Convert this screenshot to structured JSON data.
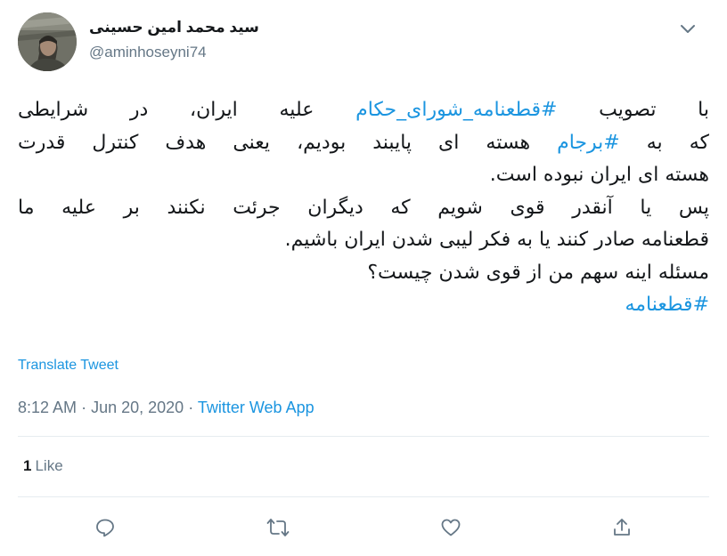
{
  "user": {
    "display_name": "سید محمد امین حسینی",
    "handle": "@aminhoseyni74"
  },
  "tweet": {
    "line1": {
      "text_a": "با تصویب ",
      "hashtag": "#قطعنامه_شورای_حکام",
      "text_b": " علیه ایران، در شرایطی"
    },
    "line2": {
      "text_a": "که به ",
      "hashtag": "#برجام",
      "text_b": " هسته ای پایبند بودیم، یعنی هدف کنترل قدرت"
    },
    "line3": "هسته ای ایران نبوده است.",
    "line4": "پس یا آنقدر قوی شویم که دیگران جرئت نکنند بر علیه ما",
    "line5": "قطعنامه صادر کنند یا به فکر لیبی شدن ایران باشیم.",
    "line6": "مسئله اینه سهم من از قوی شدن چیست؟",
    "line7_hashtag": "#قطعنامه"
  },
  "translate_label": "Translate Tweet",
  "meta": {
    "time": "8:12 AM",
    "separator": "·",
    "date": "Jun 20, 2020",
    "source": "Twitter Web App"
  },
  "stats": {
    "likes_count": "1",
    "likes_label": "Like"
  },
  "icons": {
    "caret": "chevron-down-icon",
    "reply": "reply-icon",
    "retweet": "retweet-icon",
    "like": "heart-icon",
    "share": "share-icon"
  },
  "colors": {
    "link": "#1b95e0",
    "text": "#14171a",
    "secondary": "#657786",
    "border": "#e6ecf0"
  }
}
